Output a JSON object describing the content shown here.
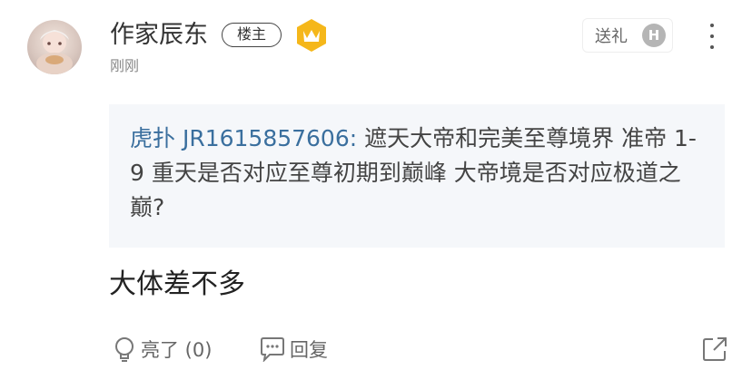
{
  "post": {
    "author": "作家辰东",
    "op_badge": "楼主",
    "time": "刚刚",
    "gift_label": "送礼",
    "gift_icon_letter": "H",
    "quote_user": "虎扑 JR1615857606:",
    "quote_text": " 遮天大帝和完美至尊境界  准帝 1-9 重天是否对应至尊初期到巅峰  大帝境是否对应极道之巅?",
    "reply_text": "大体差不多",
    "like_label": "亮了 (0)",
    "reply_label": "回复"
  },
  "colors": {
    "quote_bg": "#f5f7fa",
    "quote_user": "#3a6f9e",
    "crown_badge": "#f5b71a"
  }
}
